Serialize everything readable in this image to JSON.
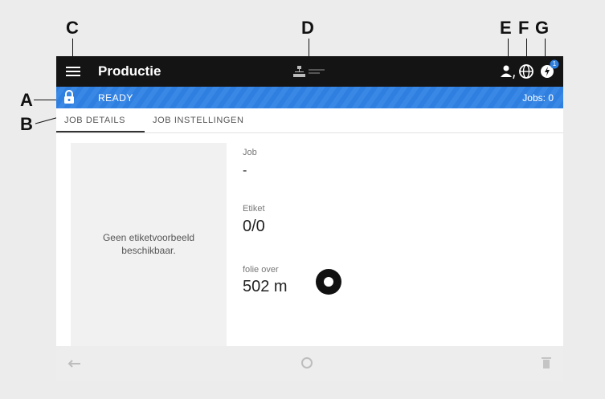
{
  "callouts": {
    "a": "A",
    "b": "B",
    "c": "C",
    "d": "D",
    "e": "E",
    "f": "F",
    "g": "G"
  },
  "header": {
    "title": "Productie",
    "notification_count": "1"
  },
  "status": {
    "state": "READY",
    "jobs": "Jobs: 0"
  },
  "tabs": [
    {
      "label": "JOB DETAILS",
      "active": true
    },
    {
      "label": "JOB INSTELLINGEN",
      "active": false
    }
  ],
  "preview": {
    "line1": "Geen etiketvoorbeeld",
    "line2": "beschikbaar."
  },
  "fields": {
    "job": {
      "label": "Job",
      "value": "-"
    },
    "label": {
      "label": "Etiket",
      "value": "0/0"
    },
    "foil": {
      "label": "folie over",
      "value": "502 m"
    }
  },
  "colors": {
    "accent": "#2f7fe0",
    "topbar": "#141414",
    "badge": "#2f7fe0"
  },
  "icons": [
    "menu-icon",
    "network-icon",
    "user-icon",
    "globe-icon",
    "notification-icon",
    "lock-icon",
    "foil-roll-icon",
    "back-icon",
    "home-icon",
    "trash-icon"
  ]
}
